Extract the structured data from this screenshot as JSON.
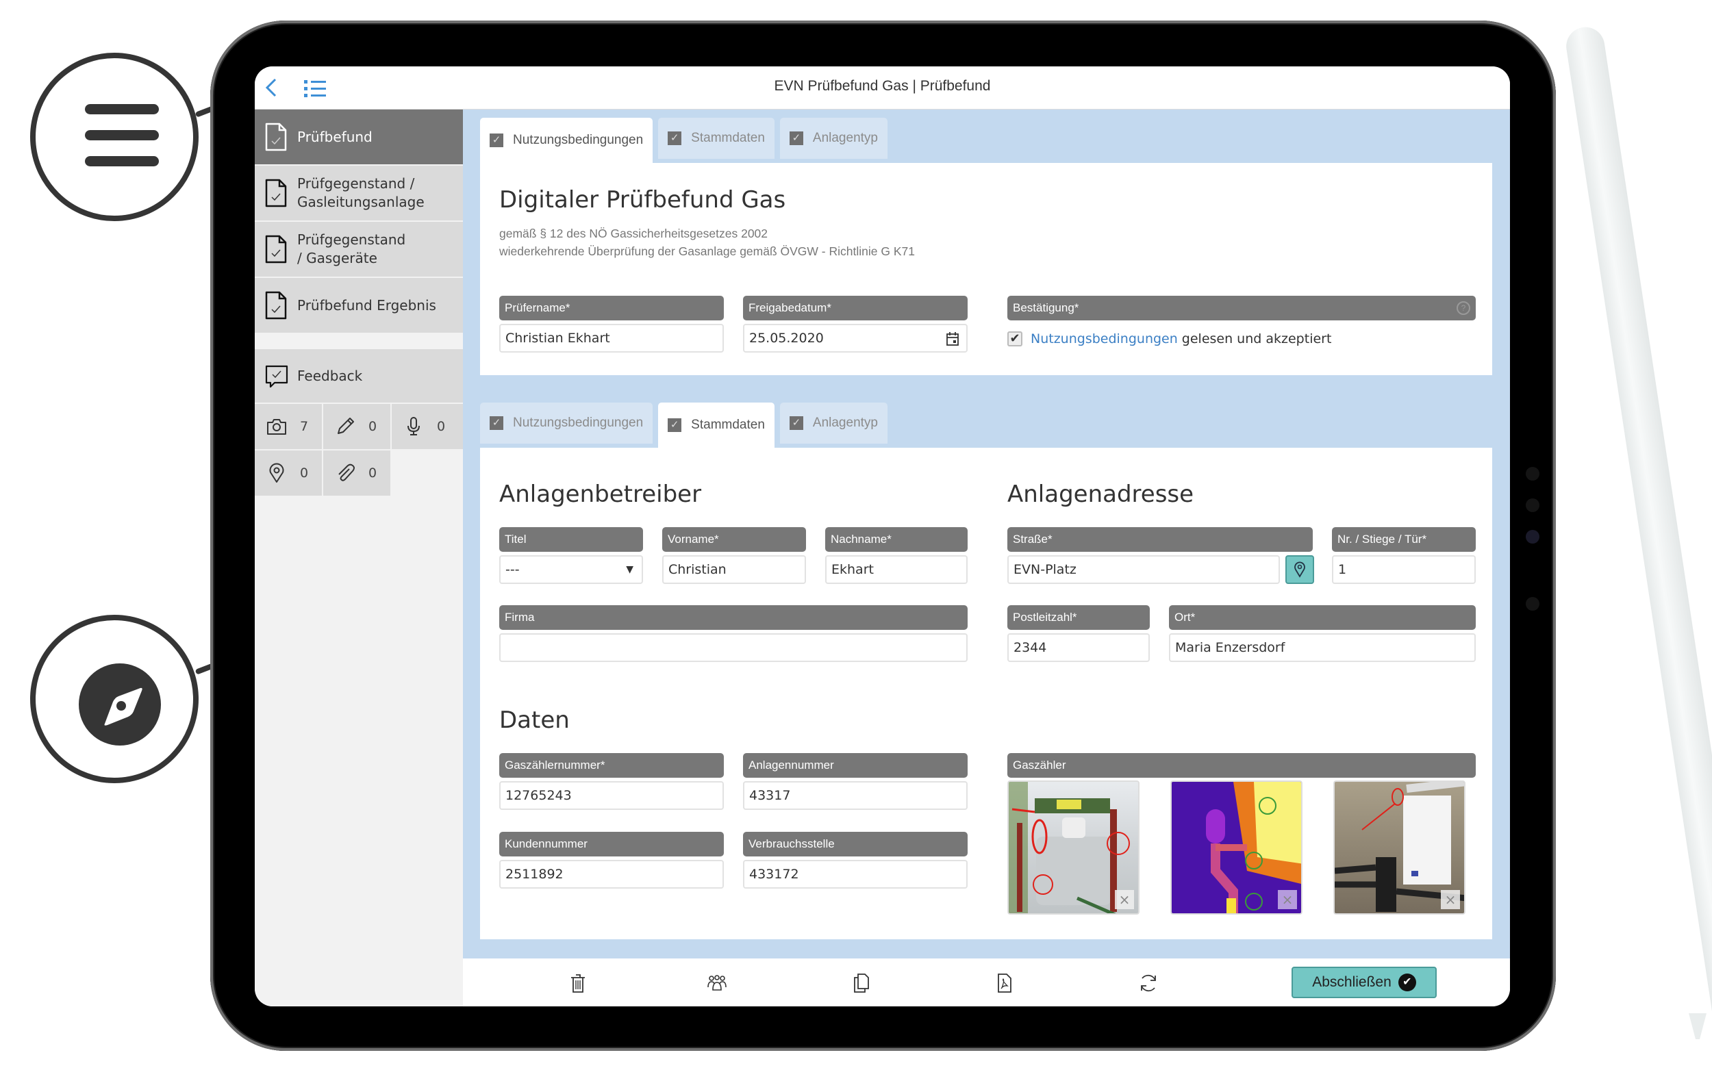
{
  "app": {
    "title": "EVN Prüfbefund Gas | Prüfbefund"
  },
  "colors": {
    "accent": "#74c7c4",
    "link": "#3b7fc4",
    "content_bg": "#c3d9ef",
    "label_bg": "#777777",
    "sidebar_active": "#757575"
  },
  "callouts": [
    {
      "icon": "hamburger-menu-icon"
    },
    {
      "icon": "compass-icon"
    }
  ],
  "topbar": {
    "back_icon": "back-chevron-icon",
    "list_icon": "list-icon"
  },
  "sidebar": {
    "items": [
      {
        "label": "Prüfbefund",
        "icon": "document-check-icon",
        "active": true
      },
      {
        "label": "Prüfgegenstand / Gasleitungsanlage",
        "icon": "document-check-icon"
      },
      {
        "label": "Prüfgegenstand / Gasgeräte",
        "icon": "document-check-icon"
      },
      {
        "label": "Prüfbefund Ergebnis",
        "icon": "document-check-icon"
      }
    ],
    "feedback": {
      "label": "Feedback",
      "icon": "feedback-check-icon"
    },
    "stats": [
      {
        "icon": "camera-icon",
        "count": "7"
      },
      {
        "icon": "pencil-icon",
        "count": "0"
      },
      {
        "icon": "microphone-icon",
        "count": "0"
      },
      {
        "icon": "location-pin-icon",
        "count": "0"
      },
      {
        "icon": "paperclip-icon",
        "count": "0"
      }
    ]
  },
  "section1": {
    "tabs": [
      {
        "label": "Nutzungsbedingungen",
        "active": true
      },
      {
        "label": "Stammdaten"
      },
      {
        "label": "Anlagentyp"
      }
    ],
    "title": "Digitaler Prüfbefund Gas",
    "subtitle_line1": "gemäß § 12 des NÖ Gassicherheitsgesetzes 2002",
    "subtitle_line2": "wiederkehrende Überprüfung der Gasanlage gemäß ÖVGW - Richtlinie G K71",
    "fields": {
      "pruefername": {
        "label": "Prüfername*",
        "value": "Christian Ekhart"
      },
      "freigabedatum": {
        "label": "Freigabedatum*",
        "value": "25.05.2020"
      },
      "bestaetigung": {
        "label": "Bestätigung*",
        "help": "?"
      }
    },
    "consent": {
      "checked": "✔",
      "link": "Nutzungsbedingungen",
      "text": "gelesen und akzeptiert"
    }
  },
  "section2": {
    "tabs": [
      {
        "label": "Nutzungsbedingungen"
      },
      {
        "label": "Stammdaten",
        "active": true
      },
      {
        "label": "Anlagentyp"
      }
    ],
    "betreiber": {
      "heading": "Anlagenbetreiber",
      "titel": {
        "label": "Titel",
        "value": "---"
      },
      "vorname": {
        "label": "Vorname*",
        "value": "Christian"
      },
      "nachname": {
        "label": "Nachname*",
        "value": "Ekhart"
      },
      "firma": {
        "label": "Firma",
        "value": ""
      }
    },
    "adresse": {
      "heading": "Anlagenadresse",
      "strasse": {
        "label": "Straße*",
        "value": "EVN-Platz"
      },
      "nr": {
        "label": "Nr. / Stiege / Tür*",
        "value": "1"
      },
      "plz": {
        "label": "Postleitzahl*",
        "value": "2344"
      },
      "ort": {
        "label": "Ort*",
        "value": "Maria Enzersdorf"
      }
    },
    "daten": {
      "heading": "Daten",
      "gaszaehlernummer": {
        "label": "Gaszählernummer*",
        "value": "12765243"
      },
      "anlagennummer": {
        "label": "Anlagennummer",
        "value": "43317"
      },
      "kundennummer": {
        "label": "Kundennummer",
        "value": "2511892"
      },
      "verbrauchsstelle": {
        "label": "Verbrauchsstelle",
        "value": "433172"
      }
    },
    "gaszaehler": {
      "label": "Gaszähler",
      "photos": [
        {
          "alt": "Gas meter photo with red annotations",
          "remove": "×"
        },
        {
          "alt": "Thermal image with green annotations",
          "remove": "×"
        },
        {
          "alt": "Boiler room photo with red annotation",
          "remove": "×"
        }
      ]
    }
  },
  "toolbar": {
    "icons": [
      "trash-icon",
      "users-icon",
      "copy-icon",
      "pdf-icon",
      "refresh-icon"
    ],
    "finish_label": "Abschließen",
    "finish_icon": "✔"
  }
}
